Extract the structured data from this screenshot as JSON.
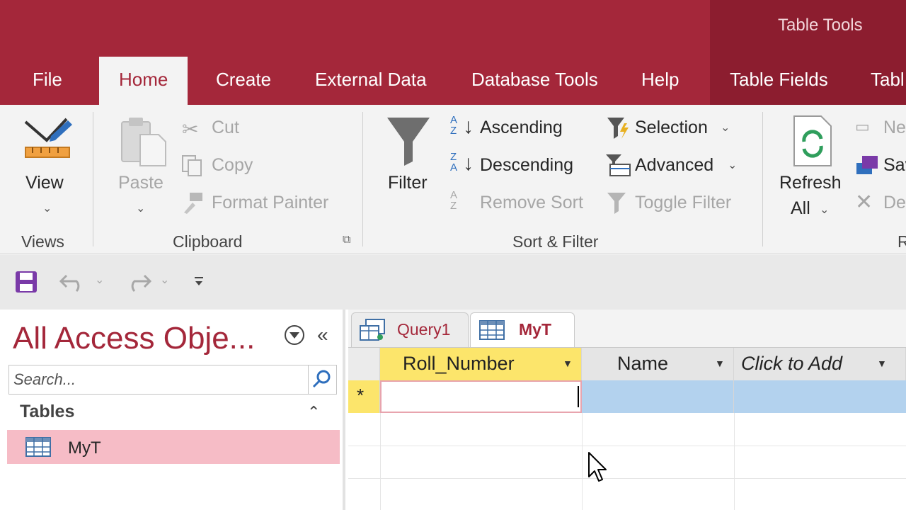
{
  "ribbon_tabs": {
    "file": "File",
    "home": "Home",
    "create": "Create",
    "external_data": "External Data",
    "database_tools": "Database Tools",
    "help": "Help",
    "table_fields": "Table Fields",
    "table_partial": "Tabl"
  },
  "contextual_title": "Table Tools",
  "views": {
    "view_label": "View",
    "group": "Views"
  },
  "clipboard": {
    "paste": "Paste",
    "cut": "Cut",
    "copy": "Copy",
    "format_painter": "Format Painter",
    "group": "Clipboard"
  },
  "sort_filter": {
    "filter": "Filter",
    "ascending": "Ascending",
    "descending": "Descending",
    "remove_sort": "Remove Sort",
    "selection": "Selection",
    "advanced": "Advanced",
    "toggle_filter": "Toggle Filter",
    "group": "Sort & Filter"
  },
  "records": {
    "refresh_line1": "Refresh",
    "refresh_line2": "All",
    "new_partial": "Ne",
    "save_partial": "Sav",
    "delete_partial": "De",
    "group_partial": "R"
  },
  "nav": {
    "title": "All Access Obje...",
    "search_placeholder": "Search...",
    "section": "Tables",
    "items": [
      {
        "label": "MyT"
      }
    ]
  },
  "doc_tabs": [
    {
      "label": "Query1"
    },
    {
      "label": "MyT"
    }
  ],
  "grid": {
    "columns": [
      "Roll_Number",
      "Name",
      "Click to Add"
    ],
    "new_row_marker": "*"
  },
  "colors": {
    "brand": "#a4273a",
    "contextual": "#8c1d2f",
    "selected_header": "#fce56b",
    "selected_row": "#b3d2ee",
    "nav_highlight": "#f6bcc6"
  }
}
